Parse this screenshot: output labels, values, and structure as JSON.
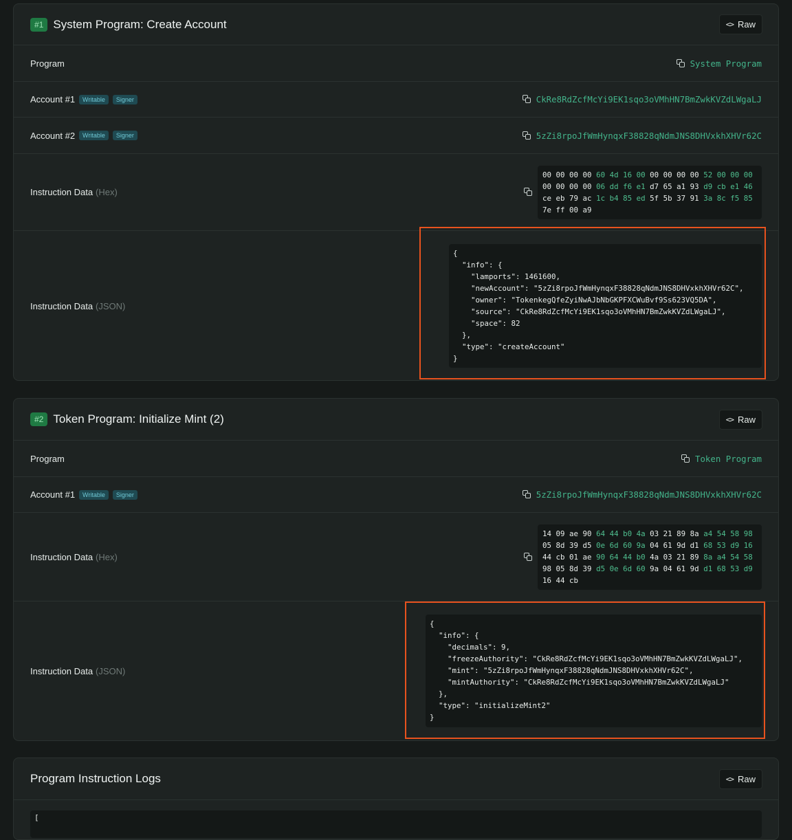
{
  "instructions": [
    {
      "number": "#1",
      "title": "System Program: Create Account",
      "raw_label": "Raw",
      "program_label": "Program",
      "program_value": "System Program",
      "accounts": [
        {
          "label": "Account #1",
          "tags": [
            "Writable",
            "Signer"
          ],
          "address": "CkRe8RdZcfMcYi9EK1sqo3oVMhHN7BmZwkKVZdLWgaLJ"
        },
        {
          "label": "Account #2",
          "tags": [
            "Writable",
            "Signer"
          ],
          "address": "5zZi8rpoJfWmHynqxF38828qNdmJNS8DHVxkhXHVr62C"
        }
      ],
      "hex_label": "Instruction Data",
      "hex_sub": "(Hex)",
      "hex_lines": [
        [
          "00",
          "00",
          "00",
          "00",
          "60",
          "4d",
          "16",
          "00",
          "00",
          "00",
          "00",
          "00",
          "52",
          "00",
          "00",
          "00"
        ],
        [
          "00",
          "00",
          "00",
          "00",
          "06",
          "dd",
          "f6",
          "e1",
          "d7",
          "65",
          "a1",
          "93",
          "d9",
          "cb",
          "e1",
          "46"
        ],
        [
          "ce",
          "eb",
          "79",
          "ac",
          "1c",
          "b4",
          "85",
          "ed",
          "5f",
          "5b",
          "37",
          "91",
          "3a",
          "8c",
          "f5",
          "85"
        ],
        [
          "7e",
          "ff",
          "00",
          "a9"
        ]
      ],
      "json_label": "Instruction Data",
      "json_sub": "(JSON)",
      "json_text": "{\n  \"info\": {\n    \"lamports\": 1461600,\n    \"newAccount\": \"5zZi8rpoJfWmHynqxF38828qNdmJNS8DHVxkhXHVr62C\",\n    \"owner\": \"TokenkegQfeZyiNwAJbNbGKPFXCWuBvf9Ss623VQ5DA\",\n    \"source\": \"CkRe8RdZcfMcYi9EK1sqo3oVMhHN7BmZwkKVZdLWgaLJ\",\n    \"space\": 82\n  },\n  \"type\": \"createAccount\"\n}"
    },
    {
      "number": "#2",
      "title": "Token Program: Initialize Mint (2)",
      "raw_label": "Raw",
      "program_label": "Program",
      "program_value": "Token Program",
      "accounts": [
        {
          "label": "Account #1",
          "tags": [
            "Writable",
            "Signer"
          ],
          "address": "5zZi8rpoJfWmHynqxF38828qNdmJNS8DHVxkhXHVr62C"
        }
      ],
      "hex_label": "Instruction Data",
      "hex_sub": "(Hex)",
      "hex_lines": [
        [
          "14",
          "09",
          "ae",
          "90",
          "64",
          "44",
          "b0",
          "4a",
          "03",
          "21",
          "89",
          "8a",
          "a4",
          "54",
          "58",
          "98"
        ],
        [
          "05",
          "8d",
          "39",
          "d5",
          "0e",
          "6d",
          "60",
          "9a",
          "04",
          "61",
          "9d",
          "d1",
          "68",
          "53",
          "d9",
          "16"
        ],
        [
          "44",
          "cb",
          "01",
          "ae",
          "90",
          "64",
          "44",
          "b0",
          "4a",
          "03",
          "21",
          "89",
          "8a",
          "a4",
          "54",
          "58"
        ],
        [
          "98",
          "05",
          "8d",
          "39",
          "d5",
          "0e",
          "6d",
          "60",
          "9a",
          "04",
          "61",
          "9d",
          "d1",
          "68",
          "53",
          "d9"
        ],
        [
          "16",
          "44",
          "cb"
        ]
      ],
      "json_label": "Instruction Data",
      "json_sub": "(JSON)",
      "json_text": "{\n  \"info\": {\n    \"decimals\": 9,\n    \"freezeAuthority\": \"CkRe8RdZcfMcYi9EK1sqo3oVMhHN7BmZwkKVZdLWgaLJ\",\n    \"mint\": \"5zZi8rpoJfWmHynqxF38828qNdmJNS8DHVxkhXHVr62C\",\n    \"mintAuthority\": \"CkRe8RdZcfMcYi9EK1sqo3oVMhHN7BmZwkKVZdLWgaLJ\"\n  },\n  \"type\": \"initializeMint2\"\n}"
    }
  ],
  "logs": {
    "title": "Program Instruction Logs",
    "raw_label": "Raw",
    "content": "["
  },
  "colors": {
    "background": "#161a19",
    "card": "#1e2322",
    "accent_green": "#43b38a",
    "highlight": "#e8521e"
  },
  "icons": [
    "code-icon",
    "copy-icon"
  ]
}
